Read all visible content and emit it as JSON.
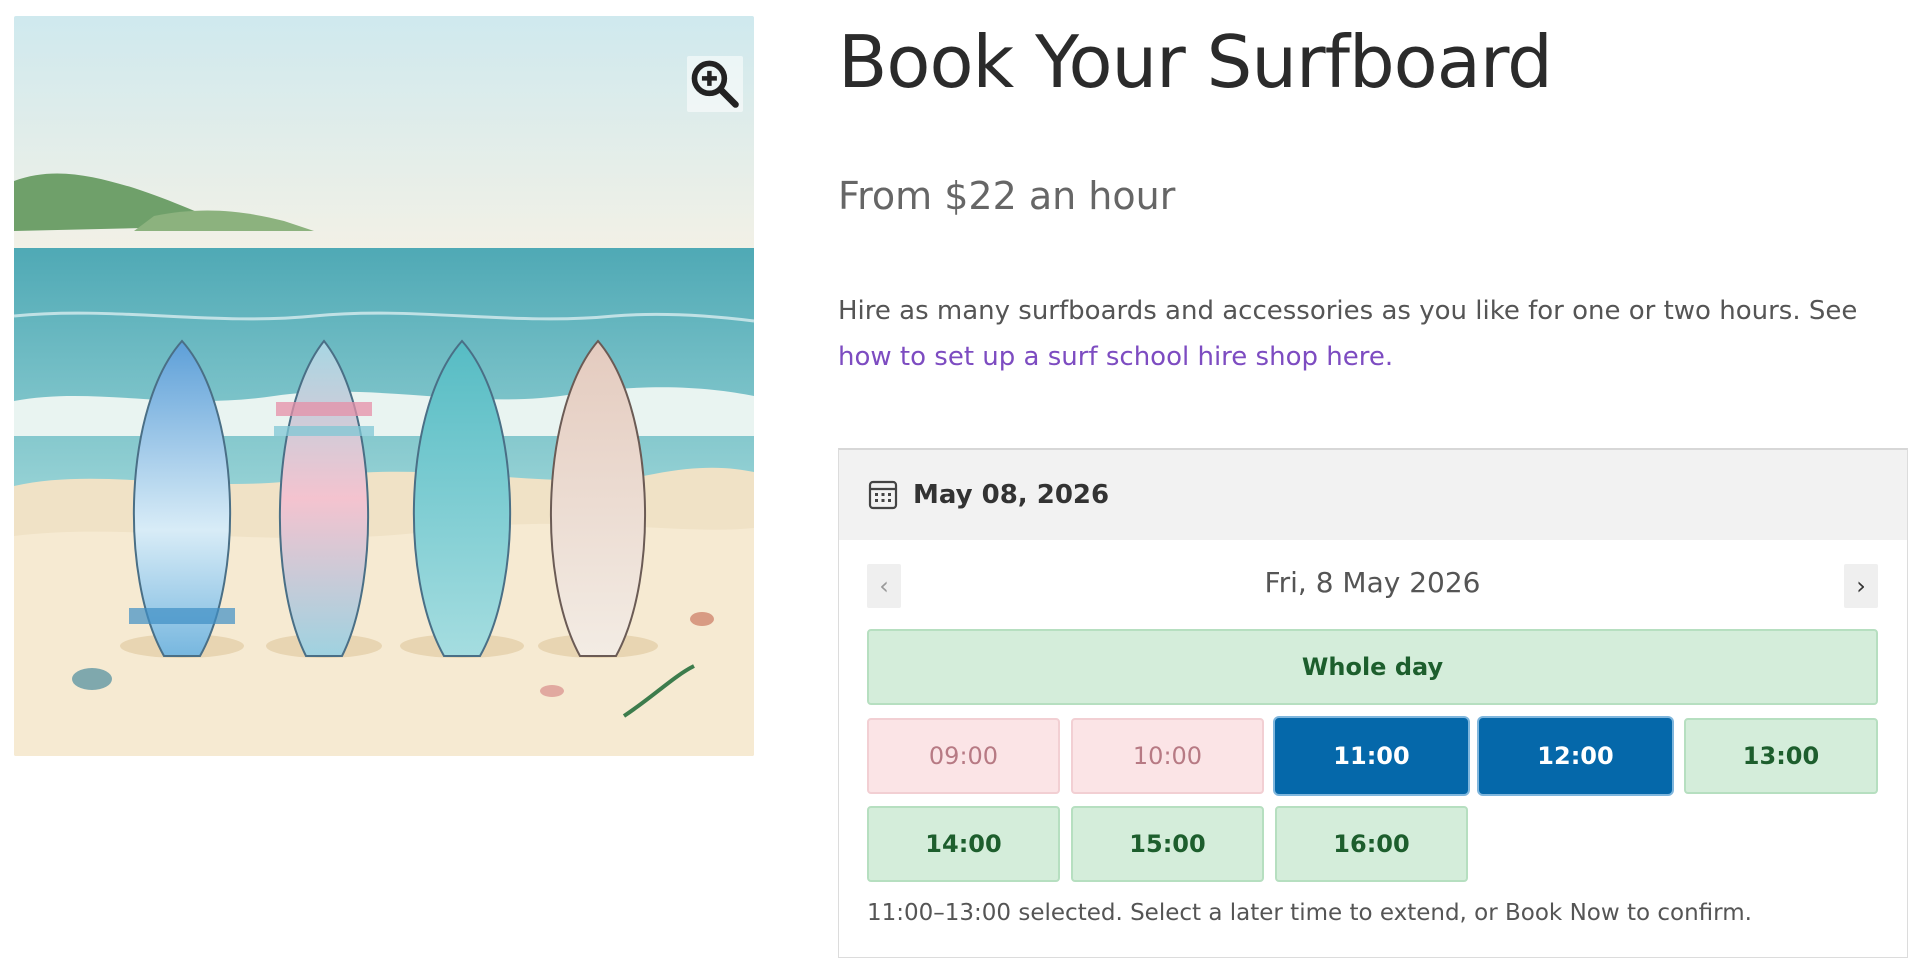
{
  "product": {
    "title": "Book Your Surfboard",
    "price": "From $22 an hour",
    "description": "Hire as many surfboards and accessories as you like for one or two hours. See ",
    "link_text": "how to set up a surf school hire shop here."
  },
  "image": {
    "zoom_icon": "zoom-in-icon"
  },
  "booking": {
    "date_icon": "calendar-icon",
    "selected_date": "May 08, 2026",
    "day_label": "Fri, 8 May 2026",
    "prev_symbol": "‹",
    "next_symbol": "›",
    "whole_day": "Whole day",
    "slots": [
      {
        "time": "09:00",
        "state": "unavailable"
      },
      {
        "time": "10:00",
        "state": "unavailable"
      },
      {
        "time": "11:00",
        "state": "selected"
      },
      {
        "time": "12:00",
        "state": "selected"
      },
      {
        "time": "13:00",
        "state": "available"
      },
      {
        "time": "14:00",
        "state": "available"
      },
      {
        "time": "15:00",
        "state": "available"
      },
      {
        "time": "16:00",
        "state": "available"
      }
    ],
    "status": "11:00–13:00 selected. Select a later time to extend, or Book Now to confirm."
  },
  "colors": {
    "link": "#7d4cc1",
    "selected": "#0568aa",
    "available_bg": "#d4edda",
    "unavailable_bg": "#fbe4e6"
  }
}
